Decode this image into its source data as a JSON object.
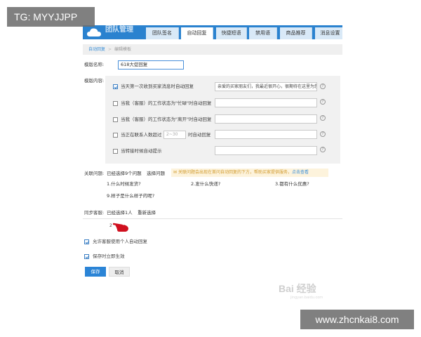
{
  "watermarks": {
    "top_left": "TG: MYYJJPP",
    "bottom_right": "www.zhcnkai8.com",
    "stamp": "Bai 经验",
    "stamp_sub": "jingyan.baidu.com"
  },
  "header": {
    "logo_text": "团队管理",
    "tabs": [
      {
        "label": "团队签名",
        "active": false
      },
      {
        "label": "自动回复",
        "active": true
      },
      {
        "label": "快捷短语",
        "active": false
      },
      {
        "label": "禁用语",
        "active": false
      },
      {
        "label": "商品推荐",
        "active": false
      },
      {
        "label": "消息设置",
        "active": false
      }
    ]
  },
  "breadcrumb": {
    "parent": "自动回复",
    "current": "编辑模板"
  },
  "form": {
    "name_label": "模版名称:",
    "name_value": "618大促回复",
    "content_label": "模版内容:",
    "options": [
      {
        "label": "当天第一次收到买家消息时自动回复",
        "checked": true,
        "reply": "亲爱的买家朋友们，我最近很开心，很期待在这里为您服务"
      },
      {
        "label": "当我（客服）的工作状态为\"忙碌\"时自动回复",
        "checked": false,
        "reply": ""
      },
      {
        "label": "当我（客服）的工作状态为\"离开\"时自动回复",
        "checked": false,
        "reply": ""
      },
      {
        "label_before": "当正在联系人数超过",
        "count_placeholder": "2~30",
        "label_after": "时自动回复",
        "checked": false,
        "reply": ""
      },
      {
        "label": "当转接时候自动提示",
        "checked": false,
        "reply": ""
      }
    ],
    "help_glyph": "?"
  },
  "related": {
    "label": "关联问题:",
    "selected_text": "已经选择9个问题",
    "choose_link": "选择问题",
    "notice": "关联问题会出现在首问自动回复的下方，帮助买家提供服务，",
    "notice_link": "点击查看",
    "questions": [
      "1.什么时候发货?",
      "2.发什么快递?",
      "3.都有什么优惠?",
      "9.样子是什么样子的呢?"
    ]
  },
  "sync": {
    "label": "同步客服:",
    "selected_text": "已经选择1人",
    "reselect_link": "重新选择",
    "user": "2"
  },
  "checks": [
    {
      "label": "允许客服使用个人自动回复",
      "checked": true
    },
    {
      "label": "保存时立即生效",
      "checked": true
    }
  ],
  "buttons": {
    "save": "保存",
    "cancel": "取消"
  },
  "colors": {
    "brand": "#2a82cf",
    "link": "#3a8fd8",
    "primary_button": "#2b84d6",
    "notice_bg": "#fdf3dc",
    "cursor": "#d0101f"
  }
}
